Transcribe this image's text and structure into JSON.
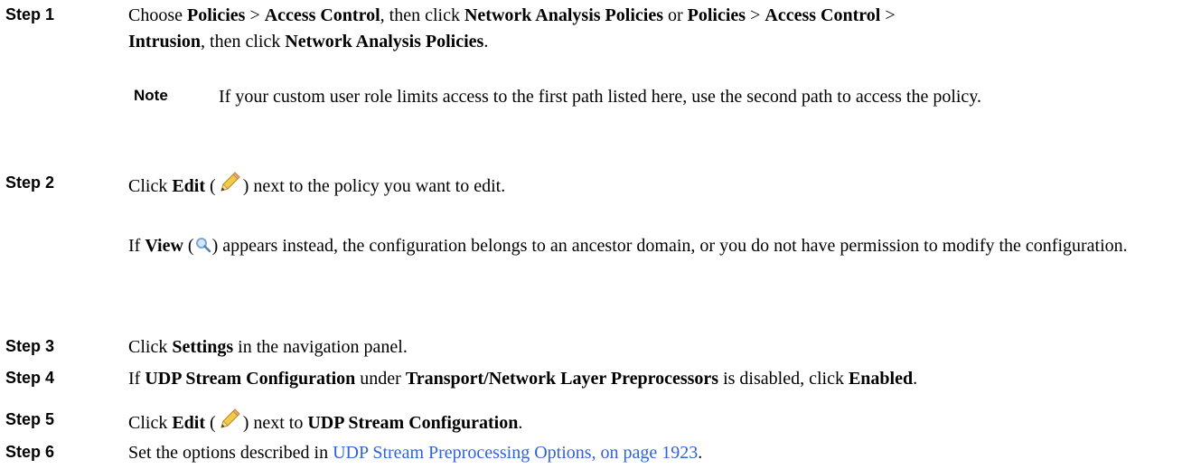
{
  "step1": {
    "label": "Step 1",
    "t1": "Choose ",
    "b1": "Policies",
    "t2": " > ",
    "b2": "Access Control",
    "t3": ", then click ",
    "b3": "Network Analysis Policies",
    "t4": " or ",
    "b4": "Policies",
    "t5": "  > ",
    "b5": "Access Control",
    "t6": " >",
    "b6": "Intrusion",
    "t7": ", then click ",
    "b7": "Network Analysis Policies",
    "t8": "."
  },
  "note": {
    "label": "Note",
    "text": "If your custom user role limits access to the first path listed here, use the second path to access the policy."
  },
  "step2": {
    "label": "Step 2",
    "t1": "Click ",
    "b1": "Edit",
    "t2": " (",
    "icon": "pencil-icon",
    "t3": ") next to the policy you want to edit.",
    "sub_t1": "If ",
    "sub_b1": "View",
    "sub_t2": " (",
    "sub_icon": "magnifier-icon",
    "sub_t3": ") appears instead, the configuration belongs to an ancestor domain, or you do not have permission to modify the configuration."
  },
  "step3": {
    "label": "Step 3",
    "t1": "Click ",
    "b1": "Settings",
    "t2": " in the navigation panel."
  },
  "step4": {
    "label": "Step 4",
    "t1": "If ",
    "b1": "UDP Stream Configuration",
    "t2": " under ",
    "b2": "Transport/Network Layer Preprocessors",
    "t3": " is disabled, click ",
    "b3": "Enabled",
    "t4": "."
  },
  "step5": {
    "label": "Step 5",
    "t1": "Click ",
    "b1": "Edit",
    "t2": " (",
    "icon": "pencil-icon",
    "t3": ") next to ",
    "b2": "UDP Stream Configuration",
    "t4": "."
  },
  "step6": {
    "label": "Step 6",
    "t1": "Set the options described in ",
    "link": "UDP Stream Preprocessing Options, on page 1923",
    "t2": "."
  },
  "colors": {
    "link": "#3063d3",
    "pencil_body": "#f2c94c",
    "magnifier": "#7aa7d9"
  }
}
